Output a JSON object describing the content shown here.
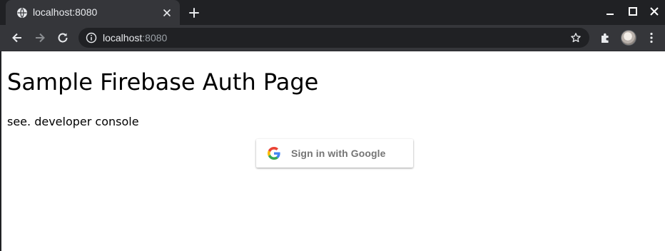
{
  "browser": {
    "tab": {
      "title": "localhost:8080",
      "favicon": "globe-icon"
    },
    "url": {
      "host": "localhost",
      "port": ":8080"
    },
    "colors": {
      "titlebar": "#202124",
      "toolbar": "#35363a",
      "omnibox": "#202124"
    }
  },
  "page": {
    "heading": "Sample Firebase Auth Page",
    "subtitle": "see. developer console",
    "signin_button": {
      "label": "Sign in with Google",
      "icon": "google-logo-icon"
    }
  }
}
